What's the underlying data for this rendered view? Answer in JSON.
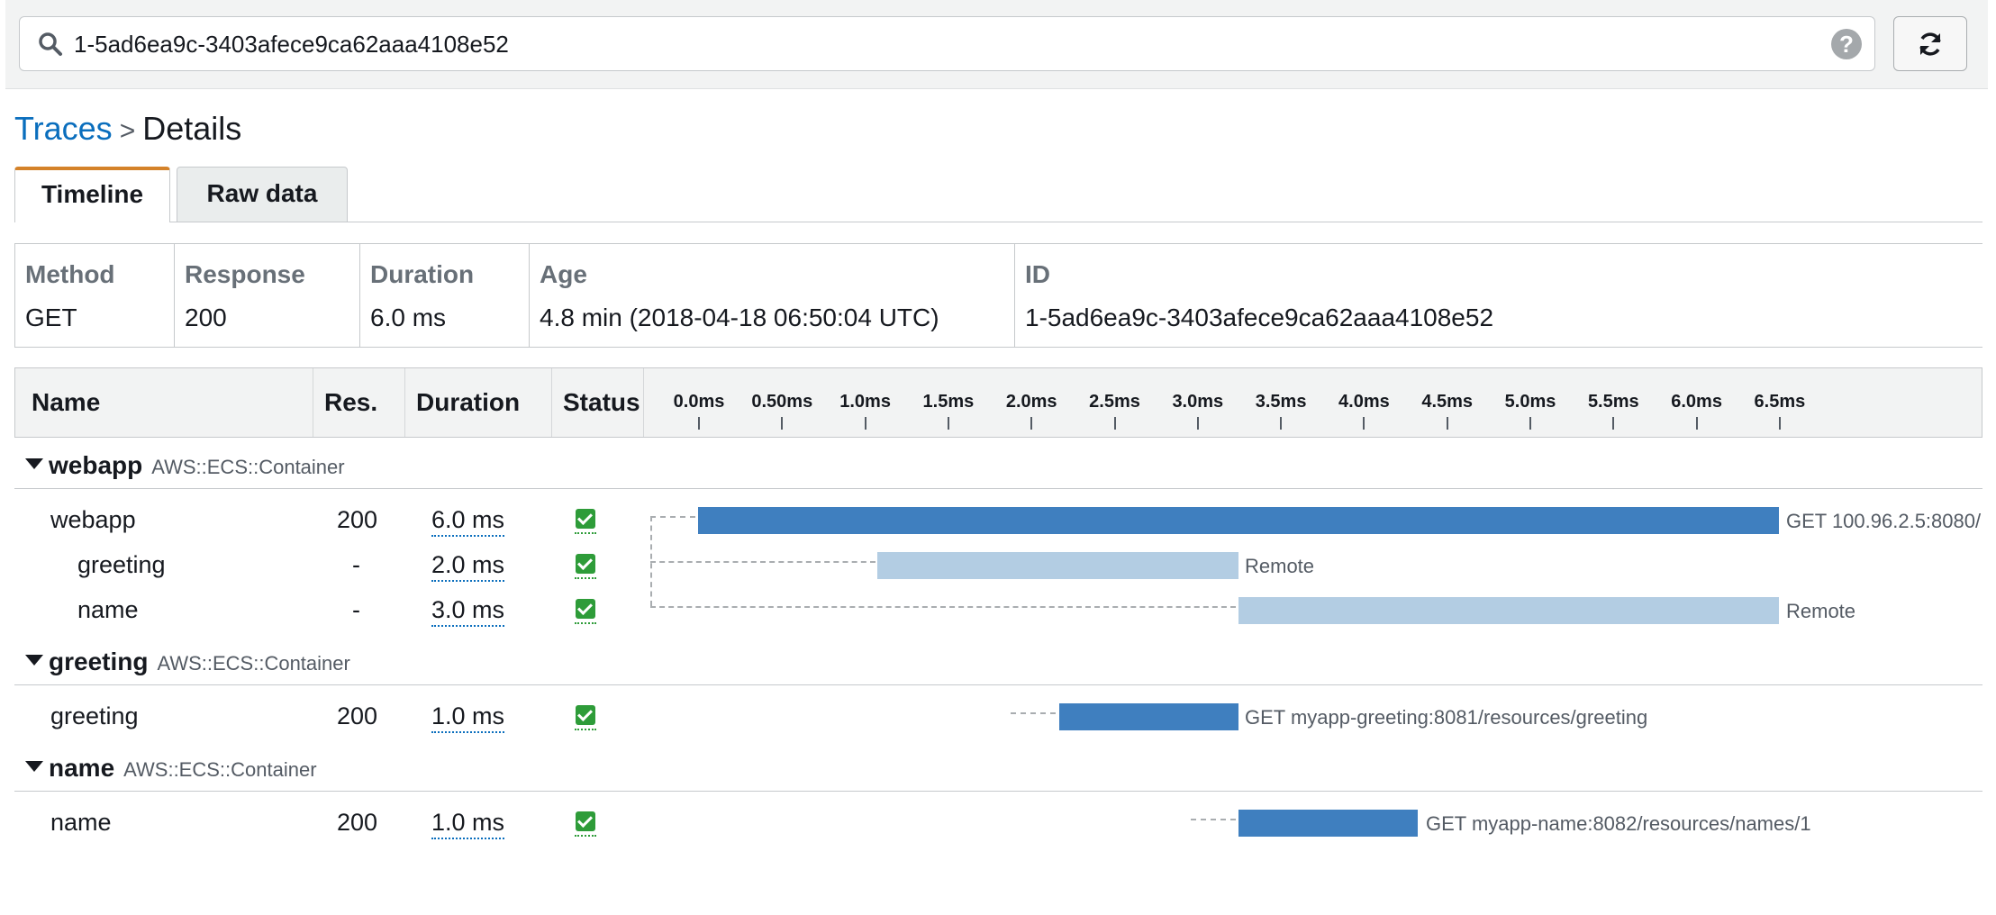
{
  "search": {
    "query": "1-5ad6ea9c-3403afece9ca62aaa4108e52",
    "help_icon": "question-circle-icon",
    "help_glyph": "?",
    "refresh_icon": "refresh-icon"
  },
  "breadcrumb": {
    "link": "Traces",
    "separator": ">",
    "current": "Details"
  },
  "tabs": [
    {
      "label": "Timeline",
      "active": true
    },
    {
      "label": "Raw data",
      "active": false
    }
  ],
  "summary": {
    "method": {
      "label": "Method",
      "value": "GET"
    },
    "response": {
      "label": "Response",
      "value": "200"
    },
    "duration": {
      "label": "Duration",
      "value": "6.0 ms"
    },
    "age": {
      "label": "Age",
      "value": "4.8 min (2018-04-18 06:50:04 UTC)"
    },
    "id": {
      "label": "ID",
      "value": "1-5ad6ea9c-3403afece9ca62aaa4108e52"
    }
  },
  "table": {
    "headers": {
      "name": "Name",
      "res": "Res.",
      "duration": "Duration",
      "status": "Status"
    },
    "ticks": [
      "0.0ms",
      "0.50ms",
      "1.0ms",
      "1.5ms",
      "2.0ms",
      "2.5ms",
      "3.0ms",
      "3.5ms",
      "4.0ms",
      "4.5ms",
      "5.0ms",
      "5.5ms",
      "6.0ms",
      "6.5ms"
    ]
  },
  "groups": [
    {
      "name": "webapp",
      "type": "AWS::ECS::Container"
    },
    {
      "name": "greeting",
      "type": "AWS::ECS::Container"
    },
    {
      "name": "name",
      "type": "AWS::ECS::Container"
    }
  ],
  "rows": [
    {
      "name": "webapp",
      "res": "200",
      "duration": "6.0 ms",
      "status": "ok",
      "start_ms": 0.0,
      "end_ms": 6.5,
      "label": "GET 100.96.2.5:8080/"
    },
    {
      "name": "greeting",
      "res": "-",
      "duration": "2.0 ms",
      "status": "ok",
      "start_ms": 1.08,
      "end_ms": 3.25,
      "label": "Remote"
    },
    {
      "name": "name",
      "res": "-",
      "duration": "3.0 ms",
      "status": "ok",
      "start_ms": 3.25,
      "end_ms": 6.5,
      "label": "Remote"
    },
    {
      "name": "greeting",
      "res": "200",
      "duration": "1.0 ms",
      "status": "ok",
      "start_ms": 2.17,
      "end_ms": 3.25,
      "label": "GET myapp-greeting:8081/resources/greeting"
    },
    {
      "name": "name",
      "res": "200",
      "duration": "1.0 ms",
      "status": "ok",
      "start_ms": 3.25,
      "end_ms": 4.33,
      "label": "GET myapp-name:8082/resources/names/1"
    }
  ]
}
